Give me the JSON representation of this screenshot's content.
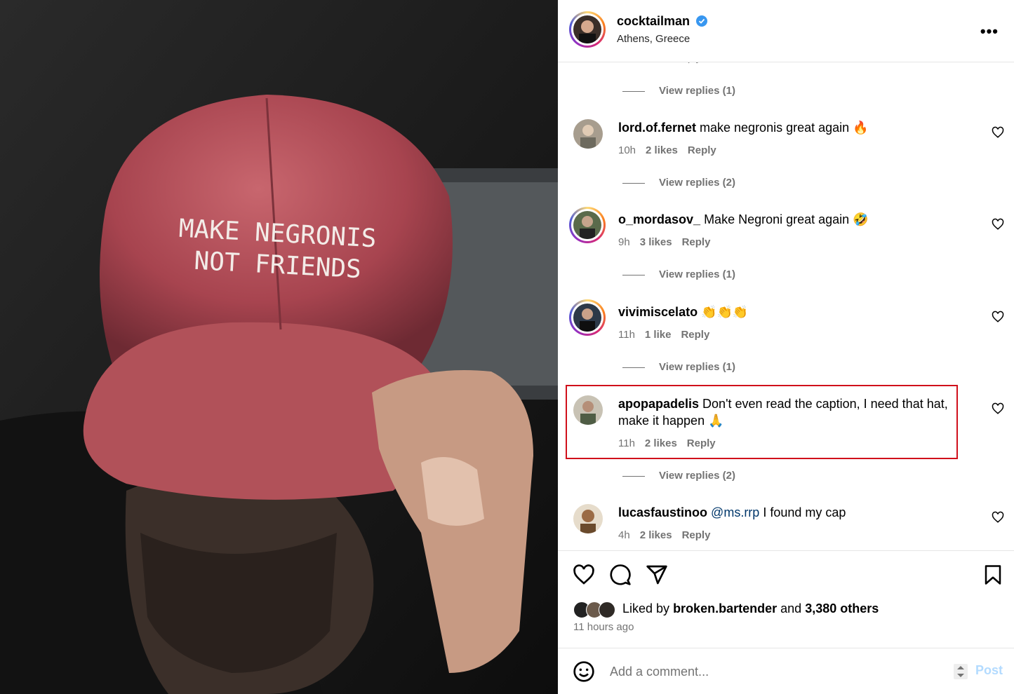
{
  "post": {
    "username": "cocktailman",
    "location": "Athens, Greece",
    "more_label": "•••",
    "cap_text_line1": "MAKE NEGRONIS",
    "cap_text_line2": "NOT FRIENDS"
  },
  "comments": [
    {
      "view_replies": "View replies (1)"
    },
    {
      "user": "lord.of.fernet",
      "text": "make negronis great again 🔥",
      "time": "10h",
      "likes": "2 likes",
      "reply": "Reply",
      "view_replies": "View replies (2)"
    },
    {
      "user": "o_mordasov_",
      "text": "Make Negroni great again 🤣",
      "time": "9h",
      "likes": "3 likes",
      "reply": "Reply",
      "view_replies": "View replies (1)"
    },
    {
      "user": "vivimiscelato",
      "text": "👏👏👏",
      "time": "11h",
      "likes": "1 like",
      "reply": "Reply",
      "view_replies": "View replies (1)"
    },
    {
      "user": "apopapadelis",
      "text": "Don't even read the caption, I need that hat, make it happen 🙏",
      "time": "11h",
      "likes": "2 likes",
      "reply": "Reply",
      "view_replies": "View replies (2)"
    },
    {
      "user": "lucasfaustinoo",
      "mention": "@ms.rrp",
      "text": "I found my cap",
      "time": "4h",
      "likes": "2 likes",
      "reply": "Reply"
    }
  ],
  "actions": {
    "liked_by_prefix": "Liked by",
    "liked_by_user": "broken.bartender",
    "liked_by_and": "and",
    "liked_by_others": "3,380 others",
    "time_ago": "11 hours ago"
  },
  "add_comment": {
    "placeholder": "Add a comment...",
    "post_label": "Post"
  },
  "colors": {
    "highlight_border": "#d0101b",
    "verified_blue": "#3897f0",
    "post_button": "#b3dbff"
  }
}
